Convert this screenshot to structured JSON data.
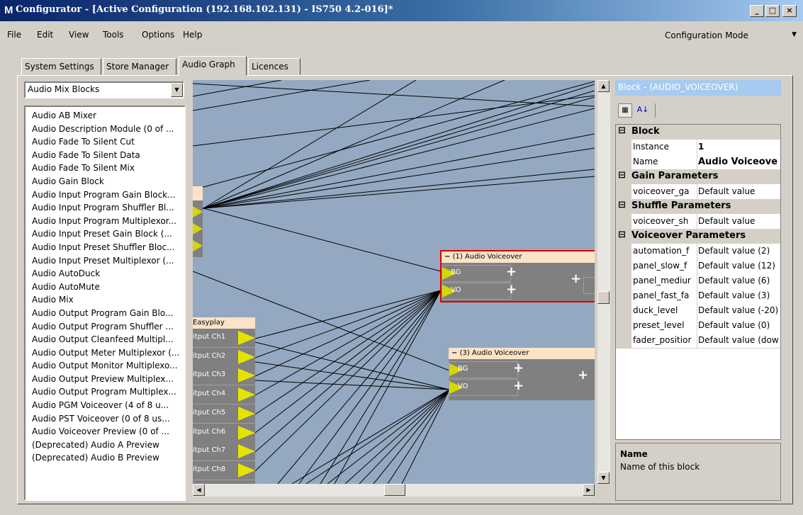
{
  "window": {
    "logo": "M",
    "title": "Configurator - [Active Configuration (192.168.102.131) - IS750 4.2-016]*",
    "controls": {
      "minimize": "_",
      "maximize": "□",
      "close": "×"
    }
  },
  "menubar": {
    "items": [
      "File",
      "Edit",
      "View",
      "Tools",
      "Options",
      "Help"
    ],
    "mode": "Configuration Mode"
  },
  "tabs": [
    "System Settings",
    "Store Manager",
    "Audio Graph",
    "Licences"
  ],
  "active_tab": "Audio Graph",
  "left_panel": {
    "combo_value": "Audio Mix Blocks",
    "items": [
      "Audio AB Mixer",
      "Audio Description Module (0 of ...",
      "Audio Fade To Silent Cut",
      "Audio Fade To Silent Data",
      "Audio Fade To Silent Mix",
      "Audio Gain Block",
      "Audio Input Program Gain Block...",
      "Audio Input Program Shuffler Bl...",
      "Audio Input Program Multiplexor...",
      "Audio Input Preset Gain Block (...",
      "Audio Input Preset Shuffler Bloc...",
      "Audio Input Preset Multiplexor (...",
      "Audio AutoDuck",
      "Audio AutoMute",
      "Audio Mix",
      "Audio Output Program Gain Blo...",
      "Audio Output Program Shuffler ...",
      "Audio Output Cleanfeed Multipl...",
      "Audio Output Meter Multiplexor (...",
      "Audio Output Monitor Multiplexo...",
      "Audio Output Preview Multiplex...",
      "Audio Output Program Multiplex...",
      "Audio PGM Voiceover (4 of 8 u...",
      "Audio PST Voiceover (0 of 8 us...",
      "Audio Voiceover Preview (0 of ...",
      "(Deprecated) Audio A Preview",
      "(Deprecated) Audio B Preview"
    ]
  },
  "graph": {
    "block1": {
      "collapse": "−",
      "title": "(1) Audio Voiceover",
      "ports": [
        "BG",
        "VO"
      ],
      "plus": "+"
    },
    "block3": {
      "collapse": "−",
      "title": "(3) Audio Voiceover",
      "ports": [
        "BG",
        "VO"
      ],
      "plus": "+"
    },
    "easyplay": {
      "title": "Easyplay",
      "channels": [
        "itput Ch1",
        "itput Ch2",
        "itput Ch3",
        "itput Ch4",
        "itput Ch5",
        "itput Ch6",
        "itput Ch7",
        "itput Ch8"
      ]
    }
  },
  "properties": {
    "title": "Block - (AUDIO_VOICEOVER)",
    "categories": {
      "block": "Block",
      "gain": "Gain Parameters",
      "shuffle": "Shuffle Parameters",
      "voiceover": "Voiceover Parameters"
    },
    "collapse_glyph": "⊟",
    "rows": {
      "instance": {
        "name": "Instance",
        "value": "1"
      },
      "name": {
        "name": "Name",
        "value": "Audio Voiceove"
      },
      "voiceover_gain": {
        "name": "voiceover_ga",
        "value": "Default value"
      },
      "voiceover_shuffle": {
        "name": "voiceover_sh",
        "value": "Default value"
      },
      "automation": {
        "name": "automation_f",
        "value": "Default value (2)"
      },
      "panel_slow": {
        "name": "panel_slow_f",
        "value": "Default value (12)"
      },
      "panel_medium": {
        "name": "panel_mediur",
        "value": "Default value (6)"
      },
      "panel_fast": {
        "name": "panel_fast_fa",
        "value": "Default value (3)"
      },
      "duck_level": {
        "name": "duck_level",
        "value": "Default value (-20)"
      },
      "preset_level": {
        "name": "preset_level",
        "value": "Default value (0)"
      },
      "fader_position": {
        "name": "fader_positior",
        "value": "Default value (dow"
      }
    },
    "description": {
      "title": "Name",
      "text": "Name of this block"
    }
  },
  "colors": {
    "graph_bg": "#94a9c1",
    "block_header": "#fbe3c8",
    "port_arrow": "#d6d600",
    "selected_border": "#e00000"
  }
}
